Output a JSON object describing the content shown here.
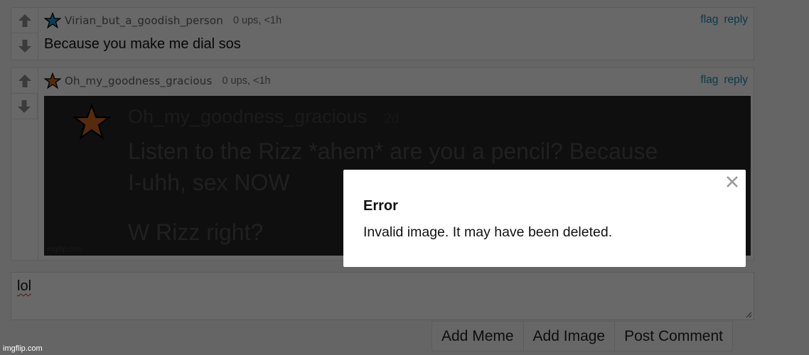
{
  "colors": {
    "link": "#1d84a6",
    "star_blue": "#1f8fc2",
    "star_orange": "#c8641e",
    "spell_underline": "#c0283a"
  },
  "comments": [
    {
      "username": "Virian_but_a_goodish_person",
      "meta": "0 ups, <1h",
      "flag": "flag",
      "reply": "reply",
      "text": "Because you make me dial sos",
      "star_icon": "star-blue-icon"
    },
    {
      "username": "Oh_my_goodness_gracious",
      "meta": "0 ups, <1h",
      "flag": "flag",
      "reply": "reply",
      "star_icon": "star-orange-icon",
      "meme": {
        "username": "Oh_my_goodness_gracious",
        "time": "2d",
        "line1": "Listen to the Rizz *ahem* are you a pencil? Because",
        "line2": "I-uhh, sex NOW",
        "line3": "W Rizz right?",
        "watermark": "imgflip.com"
      }
    }
  ],
  "composer": {
    "value": "lol",
    "buttons": [
      "Add Meme",
      "Add Image",
      "Post Comment"
    ]
  },
  "footer_watermark": "imgflip.com",
  "modal": {
    "title": "Error",
    "message": "Invalid image. It may have been deleted.",
    "close_icon": "close-icon"
  }
}
